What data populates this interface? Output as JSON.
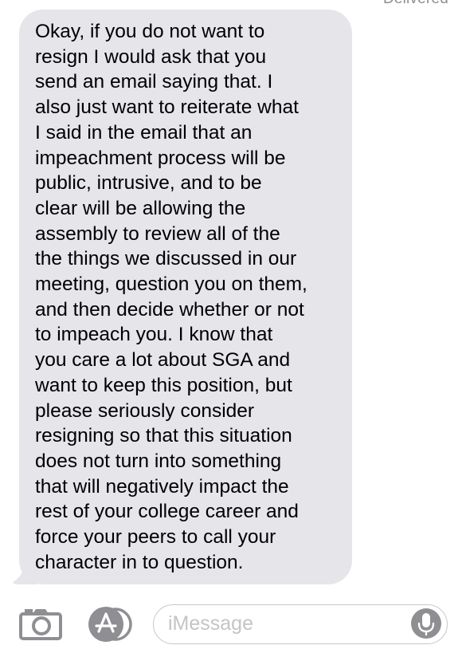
{
  "status": {
    "delivered_label": "Delivered"
  },
  "conversation": {
    "messages": [
      {
        "direction": "incoming",
        "text": "Okay, if you do not want to\nresign I would ask that you\nsend an email saying that. I\nalso just want to reiterate what\nI said in the email that an\nimpeachment process will be\npublic, intrusive, and to be\nclear will be allowing the\nassembly to review all of the\nthe things we discussed in our\nmeeting, question you on them,\nand then decide whether or not\nto impeach you. I know that\nyou care a lot about SGA and\nwant to keep this position, but\nplease seriously consider\nresigning so that this situation\ndoes not turn into something\nthat will negatively impact the\nrest of your college career and\nforce your peers to call your\ncharacter in to question."
      }
    ]
  },
  "input_bar": {
    "camera_icon": "camera-icon",
    "apps_icon": "app-store-icon",
    "mic_icon": "microphone-icon",
    "placeholder": "iMessage",
    "value": ""
  },
  "colors": {
    "incoming_bubble": "#e5e5ea",
    "icon_gray": "#8e8e93",
    "field_border": "#c7c7cc",
    "placeholder": "#c4c4c9"
  }
}
